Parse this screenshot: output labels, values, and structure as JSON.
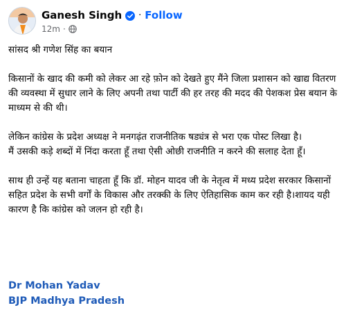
{
  "header": {
    "author_name": "Ganesh Singh",
    "follow_label": "Follow",
    "dot": "·",
    "timestamp": "12m",
    "separator": "·"
  },
  "post": {
    "title_line": "सांसद श्री गणेश सिंह का बयान",
    "para1": "किसानों के खाद की कमी को लेकर आ रहे फ़ोन को देखते हुए मैंने जिला प्रशासन को खाद्य वितरण की व्यवस्था में सुधार लाने के लिए अपनी तथा पार्टी की हर तरह की मदद की पेशकश प्रेस बयान के माध्यम से की थी।",
    "para2a": "लेकिन कांग्रेस के प्रदेश अध्यक्ष ने मनगढ़ंत राजनीतिक षड्यंत्र से भरा एक पोस्ट लिखा है।",
    "para2b": "मैं उसकी कड़े शब्दों में निंदा करता हूँ तथा ऐसी ओछी राजनीति न करने की सलाह देता हूँ।",
    "para3": "साथ ही उन्हें यह बताना चाहता हूँ कि डॉ. मोहन यादव जी के नेतृत्व में मध्य प्रदेश सरकार किसानों सहित प्रदेश के सभी वर्गों के विकास और तरक्की के लिए ऐतिहासिक काम कर रही है।शायद यही कारण है कि कांग्रेस को जलन हो रही है।"
  },
  "signature": {
    "line1": "Dr Mohan Yadav",
    "line2": "BJP Madhya Pradesh"
  },
  "colors": {
    "follow": "#0866ff",
    "verified": "#0866ff",
    "signature": "#1f5bb8",
    "meta": "#65676b"
  },
  "icons": {
    "verified": "verified-badge-icon",
    "audience": "globe-icon"
  }
}
